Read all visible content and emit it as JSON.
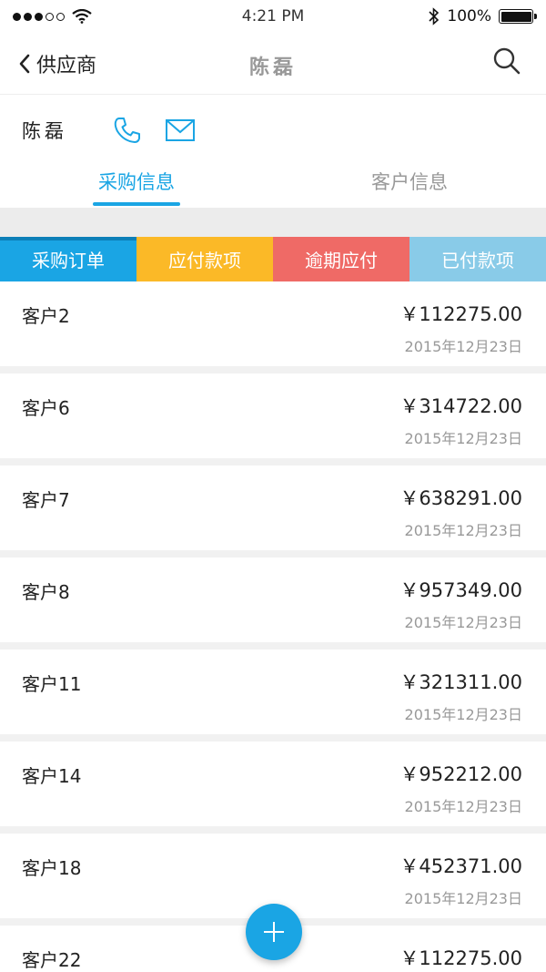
{
  "status_bar": {
    "time": "4:21 PM",
    "battery": "100%"
  },
  "nav": {
    "back_label": "供应商",
    "title": "陈磊"
  },
  "contact": {
    "name": "陈磊"
  },
  "tabs": [
    {
      "label": "采购信息",
      "active": true
    },
    {
      "label": "客户信息",
      "active": false
    }
  ],
  "status_tabs": [
    {
      "label": "采购订单"
    },
    {
      "label": "应付款项"
    },
    {
      "label": "逾期应付"
    },
    {
      "label": "已付款项"
    }
  ],
  "items": [
    {
      "name": "客户2",
      "amount": "￥112275.00",
      "date": "2015年12月23日"
    },
    {
      "name": "客户6",
      "amount": "￥314722.00",
      "date": "2015年12月23日"
    },
    {
      "name": "客户7",
      "amount": "￥638291.00",
      "date": "2015年12月23日"
    },
    {
      "name": "客户8",
      "amount": "￥957349.00",
      "date": "2015年12月23日"
    },
    {
      "name": "客户11",
      "amount": "￥321311.00",
      "date": "2015年12月23日"
    },
    {
      "name": "客户14",
      "amount": "￥952212.00",
      "date": "2015年12月23日"
    },
    {
      "name": "客户18",
      "amount": "￥452371.00",
      "date": "2015年12月23日"
    },
    {
      "name": "客户22",
      "amount": "￥112275.00",
      "date": ""
    }
  ],
  "colors": {
    "accent": "#1aa5e4",
    "yellow": "#fbb927",
    "red": "#ef6a66",
    "light_blue": "#89cbe8"
  }
}
